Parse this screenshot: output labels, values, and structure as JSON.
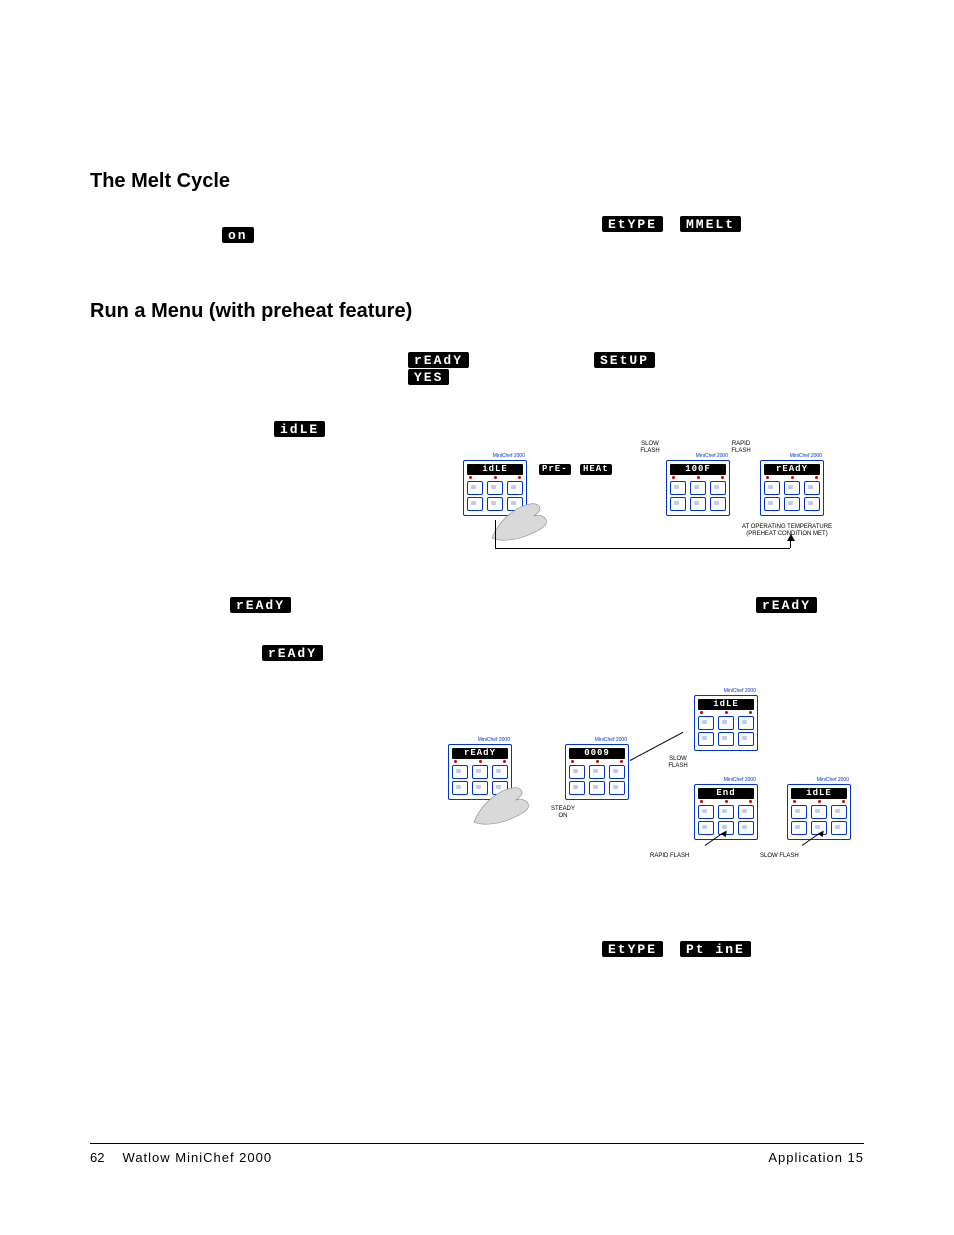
{
  "headings": {
    "melt": "The Melt Cycle",
    "run": "Run a Menu (with preheat feature)"
  },
  "seg": {
    "on": "  on",
    "etype": "EtYPE",
    "mmelt": "MMELt",
    "ready": "rEAdY",
    "yes": "  YES",
    "setup": "SEtUP",
    "idle": "  idLE",
    "pre": "PrE-",
    "heat": "HEAt",
    "100f": "100F",
    "0009": " 0009",
    "end": "  End",
    "ptime": "Pt inE"
  },
  "labels": {
    "model": "MiniChef 2000",
    "slowflash": "SLOW\nFLASH",
    "rapidflash": "RAPID\nFLASH",
    "rapidflash1": "RAPID FLASH",
    "slowflash1": "SLOW FLASH",
    "steadyon": "STEADY\nON",
    "preheatmet": "AT OPERATING TEMPERATURE\n(PREHEAT CONDITION MET)"
  },
  "footer": {
    "page": "62",
    "title": "Watlow MiniChef 2000",
    "section": "Application 15"
  }
}
